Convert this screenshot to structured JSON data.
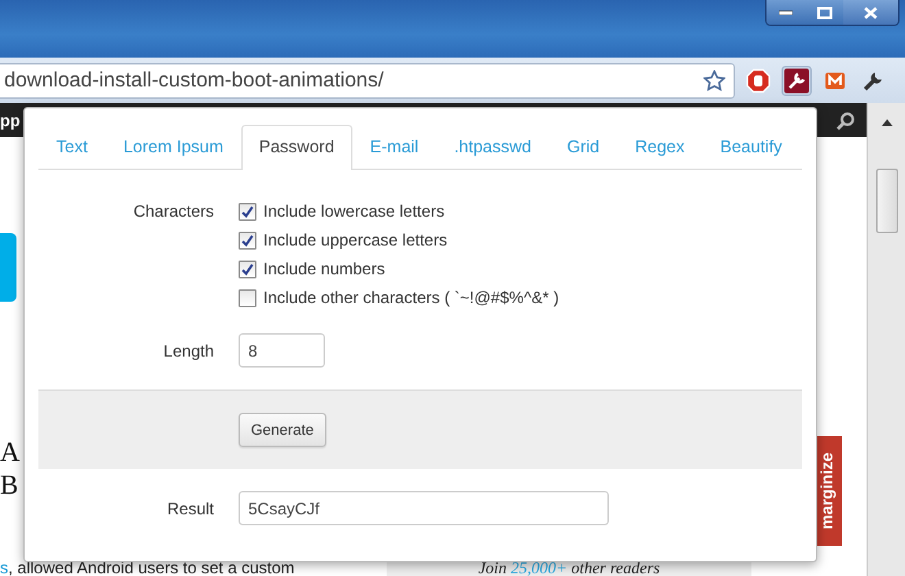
{
  "browser": {
    "url": "download-install-custom-boot-animations/"
  },
  "page": {
    "header_fragment": "pp",
    "heading_lines": [
      "A",
      "B"
    ],
    "excerpt_link": "s",
    "excerpt": ", allowed Android users to set a custom",
    "subscribe": {
      "prefix": "Join",
      "count": "25,000+",
      "suffix": "other readers"
    },
    "side_tab": "marginize"
  },
  "popup": {
    "tabs": [
      {
        "label": "Text",
        "selected": false
      },
      {
        "label": "Lorem Ipsum",
        "selected": false
      },
      {
        "label": "Password",
        "selected": true
      },
      {
        "label": "E-mail",
        "selected": false
      },
      {
        "label": ".htpasswd",
        "selected": false
      },
      {
        "label": "Grid",
        "selected": false
      },
      {
        "label": "Regex",
        "selected": false
      },
      {
        "label": "Beautify",
        "selected": false
      }
    ],
    "characters_label": "Characters",
    "options": [
      {
        "label": "Include lowercase letters",
        "checked": true
      },
      {
        "label": "Include uppercase letters",
        "checked": true
      },
      {
        "label": "Include numbers",
        "checked": true
      },
      {
        "label": "Include other characters ( `~!@#$%^&* )",
        "checked": false
      }
    ],
    "length_label": "Length",
    "length_value": "8",
    "generate_button": "Generate",
    "result_label": "Result",
    "result_value": "5CsayCJf"
  }
}
